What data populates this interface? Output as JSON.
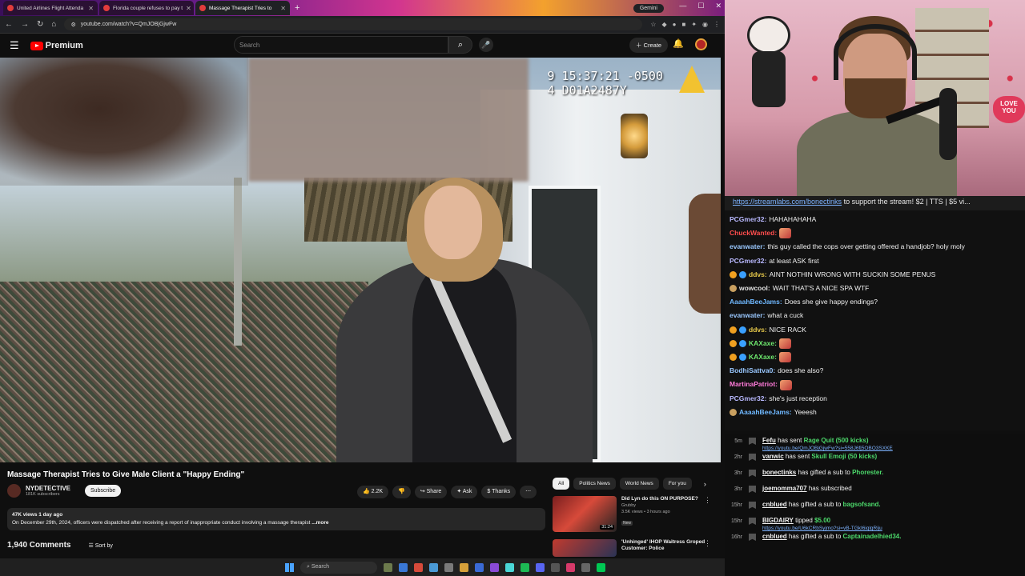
{
  "browser": {
    "tabs": [
      {
        "title": "United Airlines Flight Attenda"
      },
      {
        "title": "Florida couple refuses to pay t"
      },
      {
        "title": "Massage Therapist Tries to"
      }
    ],
    "new_tab": "+",
    "gemini": "Gemini",
    "url": "youtube.com/watch?v=QmJOBjGjwFw"
  },
  "youtube": {
    "brand": "Premium",
    "search_placeholder": "Search",
    "create_label": "Create"
  },
  "video": {
    "timestamp_line1": "9 15:37:21 -0500",
    "timestamp_line2": "4 D01A2487Y",
    "title": "Massage Therapist Tries to Give Male Client a \"Happy Ending\"",
    "channel": "NYDETECTIVE",
    "subscribers": "181K subscribers",
    "subscribe_label": "Subscribe",
    "likes": "2.2K",
    "share_label": "Share",
    "ask_label": "Ask",
    "thanks_label": "Thanks",
    "views_date": "47K views  1 day ago",
    "description": "On December 29th, 2024, officers were dispatched after receiving a report of inappropriate conduct involving a massage therapist",
    "more_label": "...more",
    "comments_count": "1,940 Comments",
    "sort_label": "Sort by"
  },
  "chips": [
    "All",
    "Politics News",
    "World News",
    "For you"
  ],
  "recommendations": [
    {
      "title": "Did Lyn do this ON PURPOSE?",
      "channel": "Grubby",
      "meta": "3.5K views • 3 hours ago",
      "badge": "New",
      "duration": "31:24"
    },
    {
      "title": "'Unhinged' IHOP Waitress Groped Customer: Police",
      "channel": "",
      "meta": "",
      "badge": "",
      "duration": ""
    }
  ],
  "taskbar": {
    "search": "Search"
  },
  "stream": {
    "ticker_link": "https://streamlabs.com/bonectinks",
    "ticker_text": "to support the stream! $2 | TTS | $5 vi...",
    "love_sign": "LOVE YOU",
    "chat": [
      {
        "user": "PCGmer32",
        "color": "#b9b9ff",
        "text": "HAHAHAHAHA",
        "badges": []
      },
      {
        "user": "ChuckWanted",
        "color": "#ff4d4d",
        "text": "",
        "badges": [],
        "emote": true
      },
      {
        "user": "evanwater",
        "color": "#9ac8ff",
        "text": "this guy called the cops over getting offered a handjob? holy moly",
        "badges": []
      },
      {
        "user": "PCGmer32",
        "color": "#b9b9ff",
        "text": "at least ASK first",
        "badges": []
      },
      {
        "user": "ddvs",
        "color": "#e6c84a",
        "text": "AINT NOTHIN WRONG WITH SUCKIN SOME PENUS",
        "badges": [
          "#f0a020",
          "#3aa0ff"
        ]
      },
      {
        "user": "wowcool",
        "color": "#e0e0e0",
        "text": "WAIT THAT'S A NICE SPA WTF",
        "badges": [
          "#c9a060"
        ]
      },
      {
        "user": "AaaahBeeJams",
        "color": "#6fb8ff",
        "text": "Does she give happy endings?",
        "badges": []
      },
      {
        "user": "evanwater",
        "color": "#9ac8ff",
        "text": "what a cuck",
        "badges": []
      },
      {
        "user": "ddvs",
        "color": "#e6c84a",
        "text": "NICE RACK",
        "badges": [
          "#f0a020",
          "#3aa0ff"
        ]
      },
      {
        "user": "KAXaxe",
        "color": "#6ee86e",
        "text": "",
        "badges": [
          "#f0a020",
          "#3aa0ff"
        ],
        "emote": true
      },
      {
        "user": "KAXaxe",
        "color": "#6ee86e",
        "text": "",
        "badges": [
          "#f0a020",
          "#3aa0ff"
        ],
        "emote": true
      },
      {
        "user": "BodhiSattva0",
        "color": "#9ac8ff",
        "text": "does she also?",
        "badges": []
      },
      {
        "user": "MartinaPatriot",
        "color": "#ff7ad9",
        "text": "",
        "badges": [],
        "emote": true
      },
      {
        "user": "PCGmer32",
        "color": "#b9b9ff",
        "text": "she's just reception",
        "badges": []
      },
      {
        "user": "AaaahBeeJams",
        "color": "#6fb8ff",
        "text": "Yeeesh",
        "badges": [
          "#c9a060"
        ]
      }
    ],
    "alerts": [
      {
        "time": "5m",
        "user": "Fefu",
        "action": "has sent",
        "item": "Rage Quit (500 kicks)",
        "link": "https://youtu.be/QmJOBjGjwFw?si=558J6fj5OBO3SXKE"
      },
      {
        "time": "2hr",
        "user": "vanwic",
        "action": "has sent",
        "item": "Skull Emoji (50 kicks)",
        "link": ""
      },
      {
        "time": "3hr",
        "user": "bonectinks",
        "action": "has gifted a sub to",
        "item": "Phorester.",
        "link": ""
      },
      {
        "time": "3hr",
        "user": "joemomma707",
        "action": "has subscribed",
        "item": "",
        "link": ""
      },
      {
        "time": "15hr",
        "user": "cnblued",
        "action": "has gifted a sub to",
        "item": "bagsofsand.",
        "link": ""
      },
      {
        "time": "15hr",
        "user": "BIGDAIRY",
        "action": "tipped",
        "item": "$5.00",
        "link": "https://youtu.be/U6kCRbSyjmo?si=vB-TGkI6iqlgRiju"
      },
      {
        "time": "16hr",
        "user": "cnblued",
        "action": "has gifted a sub to",
        "item": "Captainadelhied34.",
        "link": ""
      }
    ]
  }
}
